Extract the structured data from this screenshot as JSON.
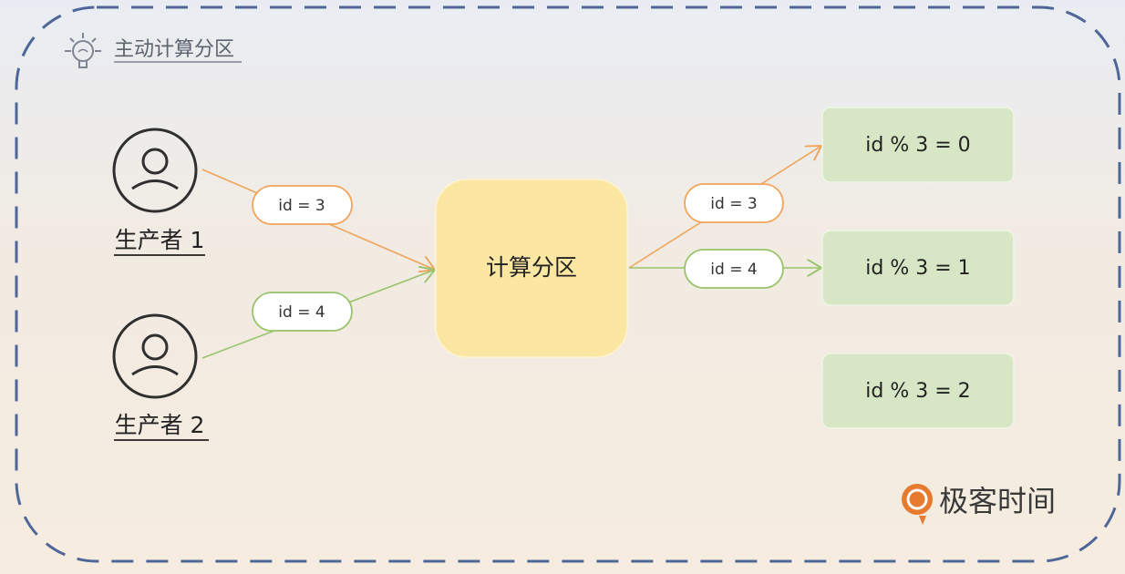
{
  "title": "主动计算分区",
  "producers": [
    {
      "label": "生产者 1"
    },
    {
      "label": "生产者 2"
    }
  ],
  "center": {
    "label": "计算分区"
  },
  "incoming_messages": [
    {
      "label": "id = 3"
    },
    {
      "label": "id = 4"
    }
  ],
  "outgoing_messages": [
    {
      "label": "id = 3"
    },
    {
      "label": "id = 4"
    }
  ],
  "partitions": [
    {
      "label": "id % 3 = 0"
    },
    {
      "label": "id % 3 = 1"
    },
    {
      "label": "id % 3 = 2"
    }
  ],
  "brand": {
    "name": "极客时间"
  },
  "colors": {
    "orange_arrow": "#f0a45a",
    "green_arrow": "#97c46a",
    "center_fill": "#fbe7a2",
    "partition_fill": "#d7e7c5",
    "dashed_border": "#4f6699",
    "brand": "#e67a2e"
  }
}
